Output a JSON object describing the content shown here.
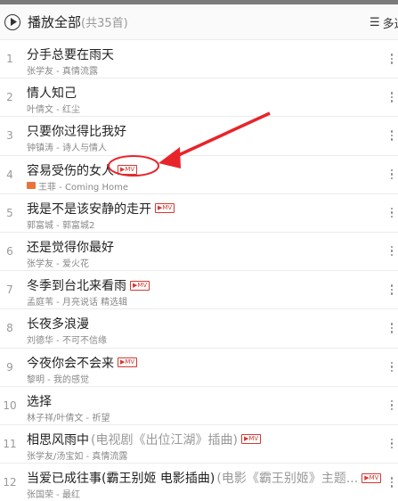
{
  "header": {
    "play_all_label": "播放全部",
    "play_all_count": "(共35首)",
    "multi_select_label": "多选",
    "list_icon": "☰"
  },
  "songs": [
    {
      "index": "1",
      "title": "分手总要在雨天",
      "artist": "张学友 - 真情流露",
      "mv": false
    },
    {
      "index": "2",
      "title": "情人知己",
      "artist": "叶倩文 - 红尘",
      "mv": false
    },
    {
      "index": "3",
      "title": "只要你过得比我好",
      "artist": "钟镇涛 - 诗人与情人",
      "mv": false
    },
    {
      "index": "4",
      "title": "容易受伤的女人",
      "artist": "王菲 - Coming Home",
      "mv": true,
      "sq": true
    },
    {
      "index": "5",
      "title": "我是不是该安静的走开",
      "artist": "郭富城 - 郭富城2",
      "mv": true
    },
    {
      "index": "6",
      "title": "还是觉得你最好",
      "artist": "张学友 - 爱火花",
      "mv": false
    },
    {
      "index": "7",
      "title": "冬季到台北来看雨",
      "artist": "孟庭苇 - 月亮说话 精选辑",
      "mv": true
    },
    {
      "index": "8",
      "title": "长夜多浪漫",
      "artist": "刘德华 - 不可不信缘",
      "mv": false
    },
    {
      "index": "9",
      "title": "今夜你会不会来",
      "artist": "黎明 - 我的感觉",
      "mv": true
    },
    {
      "index": "10",
      "title": "选择",
      "artist": "林子祥/叶倩文 - 祈望",
      "mv": false
    },
    {
      "index": "11",
      "title": "相思风雨中",
      "title_extra": "(电视剧《出位江湖》插曲)",
      "artist": "张学友/汤宝如 - 真情流露",
      "mv": true
    },
    {
      "index": "12",
      "title": "当爱已成往事(霸王别姬 电影插曲)",
      "title_extra": "(电影《霸王别姬》主题...",
      "artist": "张国荣 - 最红",
      "mv": true
    }
  ],
  "mv_label": "▶MV",
  "icons": {
    "play_all": "play-circle-icon",
    "more": "more-vertical-icon",
    "multi_select": "list-icon",
    "sq": "sq-badge-icon"
  },
  "colors": {
    "accent": "#d33a31",
    "annotation": "#e8242a"
  }
}
